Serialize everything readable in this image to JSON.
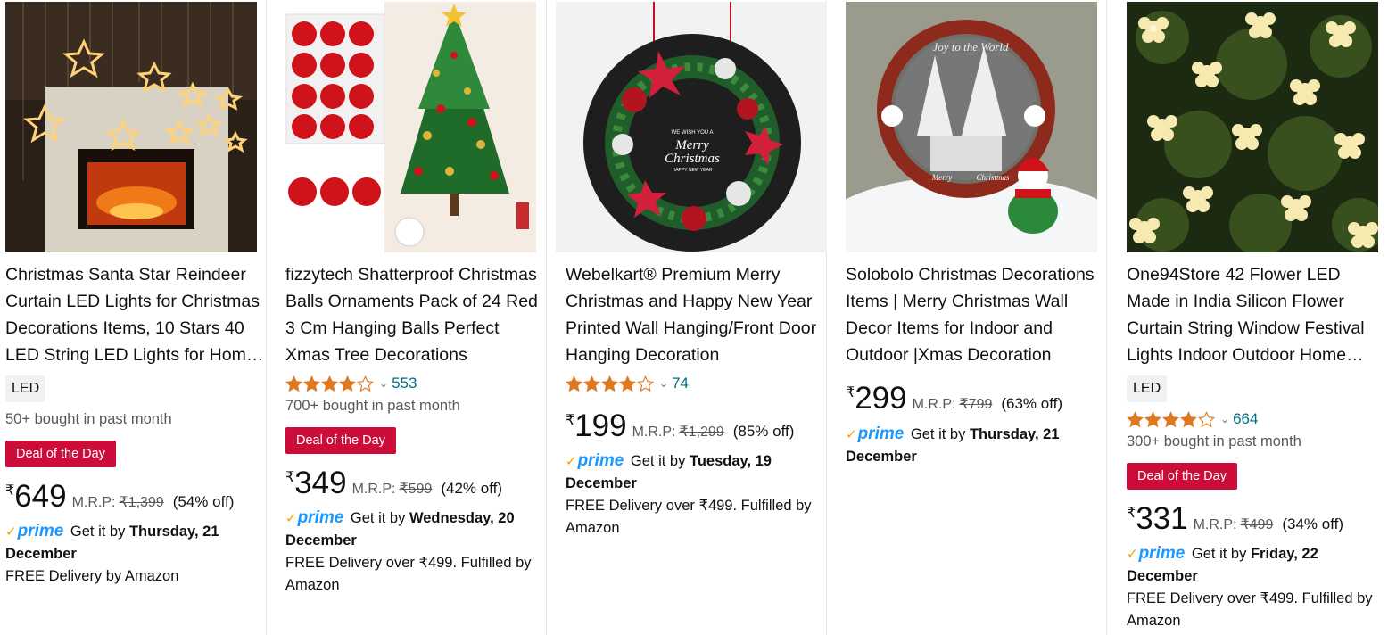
{
  "products": [
    {
      "title": "Christmas Santa Star Reindeer Curtain LED Lights for Christmas Decorations Items, 10 Stars 40 LED String LED Lights for Home Decoration",
      "tag": "LED",
      "bought": "50+ bought in past month",
      "deal": "Deal of the Day",
      "rupee": "₹",
      "price": "649",
      "mrp_label": "M.R.P:",
      "mrp": "₹1,399",
      "off": "(54% off)",
      "prime": "prime",
      "delivery_prefix": "Get it by",
      "delivery_date": "Thursday, 21 December",
      "fulfilment": "FREE Delivery by Amazon",
      "image_icon": "curtain-star-lights-image"
    },
    {
      "title": "fizzytech Shatterproof Christmas Balls Ornaments Pack of 24 Red 3 Cm Hanging Balls Perfect Xmas Tree Decorations",
      "rating": 4.0,
      "rating_count": "553",
      "bought": "700+ bought in past month",
      "deal": "Deal of the Day",
      "rupee": "₹",
      "price": "349",
      "mrp_label": "M.R.P:",
      "mrp": "₹599",
      "off": "(42% off)",
      "prime": "prime",
      "delivery_prefix": "Get it by",
      "delivery_date": "Wednesday, 20 December",
      "fulfilment": "FREE Delivery over ₹499. Fulfilled by Amazon",
      "image_icon": "christmas-balls-tree-image"
    },
    {
      "title": "Webelkart® Premium Merry Christmas and Happy New Year Printed Wall Hanging/Front Door Hanging Decoration",
      "rating": 4.0,
      "rating_count": "74",
      "rupee": "₹",
      "price": "199",
      "mrp_label": "M.R.P:",
      "mrp": "₹1,299",
      "off": "(85% off)",
      "prime": "prime",
      "delivery_prefix": "Get it by",
      "delivery_date": "Tuesday, 19 December",
      "fulfilment": "FREE Delivery over ₹499. Fulfilled by Amazon",
      "image_icon": "wreath-wall-hanging-image",
      "image_text": {
        "wish": "WE WISH YOU A",
        "merry": "Merry",
        "christmas": "Christmas",
        "newyear": "HAPPY NEW YEAR"
      }
    },
    {
      "title": "Solobolo Christmas Decorations Items | Merry Christmas Wall Decor Items for Indoor and Outdoor |Xmas Decoration",
      "rupee": "₹",
      "price": "299",
      "mrp_label": "M.R.P:",
      "mrp": "₹799",
      "off": "(63% off)",
      "prime": "prime",
      "delivery_prefix": "Get it by",
      "delivery_date": "Thursday, 21 December",
      "image_icon": "joy-to-the-world-decor-image",
      "image_text": {
        "arc": "Joy to the World",
        "merry": "Merry",
        "christmas": "Christmas"
      }
    },
    {
      "title": "One94Store 42 Flower LED Made in India Silicon Flower Curtain String Window Festival Lights Indoor Outdoor Home Decoration",
      "tag": "LED",
      "rating": 4.0,
      "rating_count": "664",
      "bought": "300+ bought in past month",
      "deal": "Deal of the Day",
      "rupee": "₹",
      "price": "331",
      "mrp_label": "M.R.P:",
      "mrp": "₹499",
      "off": "(34% off)",
      "prime": "prime",
      "delivery_prefix": "Get it by",
      "delivery_date": "Friday, 22 December",
      "fulfilment": "FREE Delivery over ₹499. Fulfilled by Amazon",
      "image_icon": "flower-led-lights-image"
    }
  ],
  "colors": {
    "deal_bg": "#cc0c39",
    "link": "#007185",
    "star": "#de7921",
    "prime_blue": "#1a98ff",
    "prime_check": "#f7a200"
  }
}
